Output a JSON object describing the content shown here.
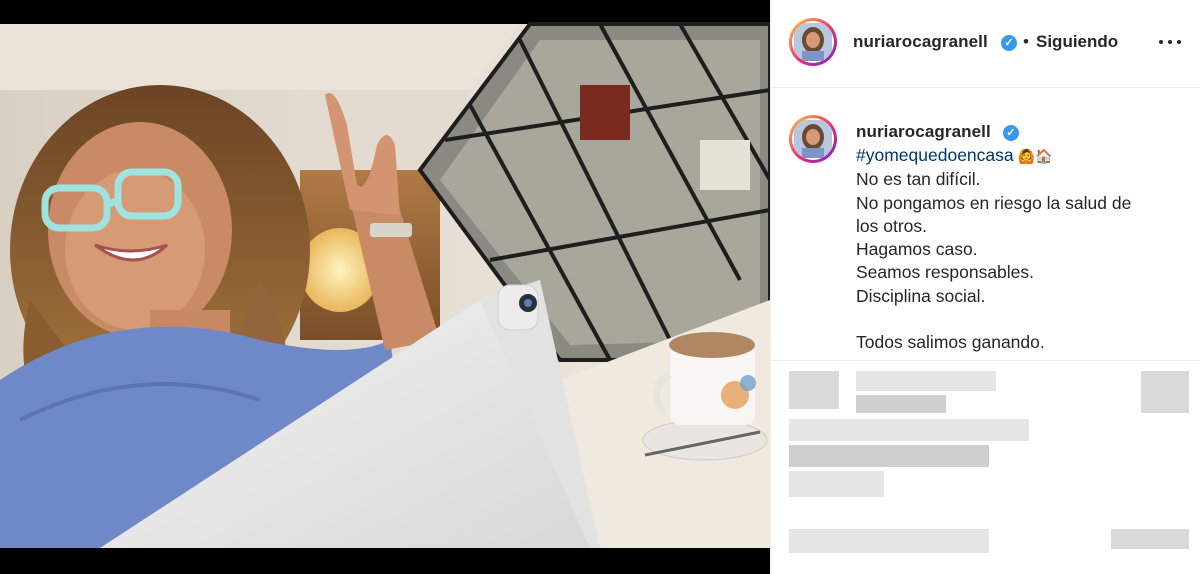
{
  "post": {
    "username": "nuriarocagranell",
    "verified_glyph": "✓",
    "separator": "•",
    "follow_status": "Siguiendo",
    "more_icon": "more-horizontal-icon"
  },
  "caption": {
    "username": "nuriarocagranell",
    "hashtag": "#yomequedoencasa",
    "emojis": "🙆🏠",
    "lines": [
      "No es tan difícil.",
      "No pongamos en riesgo la salud de",
      "los otros.",
      "Hagamos caso.",
      "Seamos responsables.",
      "Disciplina social.",
      "",
      "Todos salimos ganando."
    ]
  },
  "colors": {
    "accent_verified": "#3897f0",
    "hashtag": "#00376b",
    "text": "#262626",
    "avatar_ring": "#ee2a7b"
  }
}
